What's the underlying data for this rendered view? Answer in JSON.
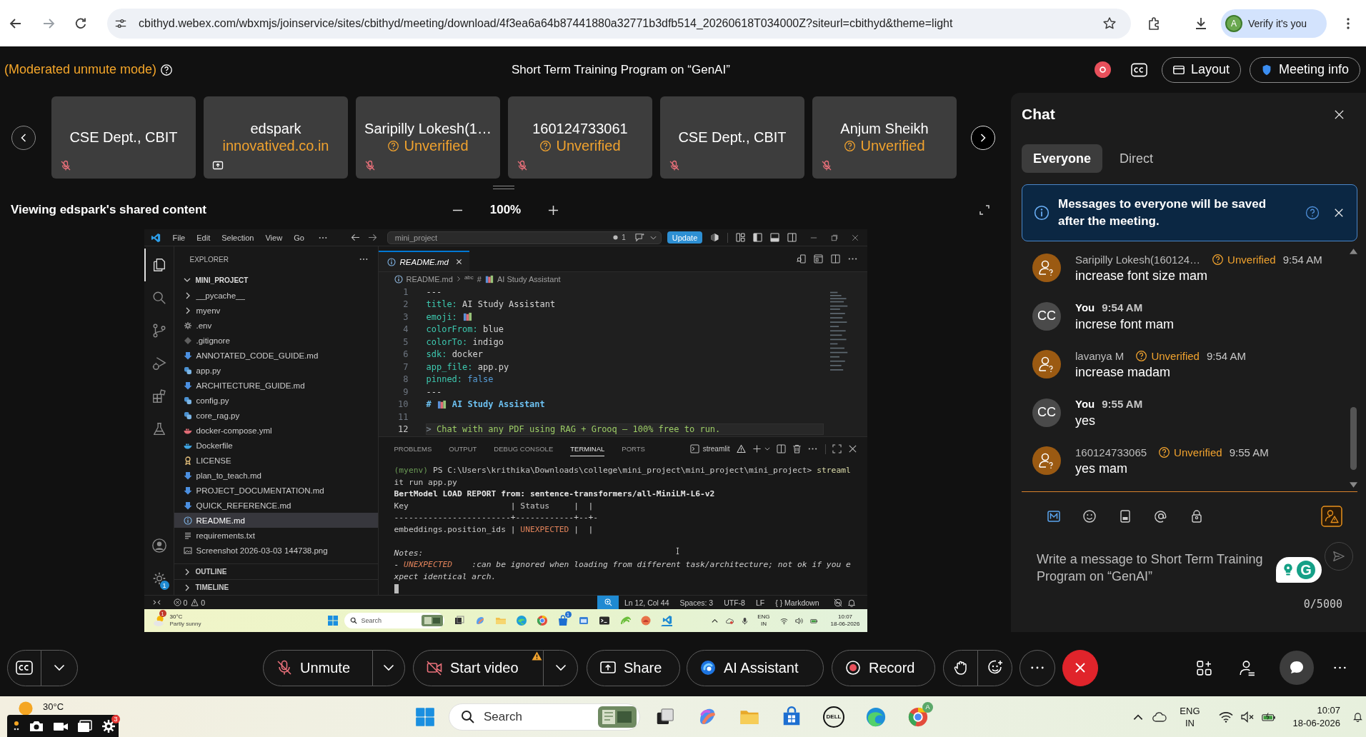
{
  "browser": {
    "url": "cbithyd.webex.com/wbxmjs/joinservice/sites/cbithyd/meeting/download/4f3ea6a64b87441880a32771b3dfb514_20260618T034000Z?siteurl=cbithyd&theme=light",
    "profile_initial": "A",
    "profile_label": "Verify it's you"
  },
  "meeting": {
    "mode_notice": "(Moderated unmute mode)",
    "title": "Short Term Training Program on “GenAI”",
    "layout_button": "Layout",
    "info_button": "Meeting info"
  },
  "participants": [
    {
      "name": "CSE Dept., CBIT",
      "muted": true,
      "sharing": false
    },
    {
      "name": "edspark",
      "note": "innovatived.co.in",
      "unverified": false,
      "muted": false,
      "sharing": true
    },
    {
      "name": "Saripilly Lokesh(1…",
      "note": "Unverified",
      "unverified": true,
      "muted": true,
      "sharing": false
    },
    {
      "name": "160124733061",
      "note": "Unverified",
      "unverified": true,
      "muted": true,
      "sharing": false
    },
    {
      "name": "CSE Dept., CBIT",
      "muted": true,
      "sharing": false
    },
    {
      "name": "Anjum Sheikh",
      "note": "Unverified",
      "unverified": true,
      "muted": true,
      "sharing": false
    }
  ],
  "share": {
    "caption": "Viewing edspark's shared content",
    "zoom": "100%"
  },
  "vscode": {
    "menu": [
      "File",
      "Edit",
      "Selection",
      "View",
      "Go"
    ],
    "command_center": "mini_project",
    "changes_count": "1",
    "update_button": "Update",
    "settings_badge": "1",
    "explorer_title": "EXPLORER",
    "project": "MINI_PROJECT",
    "files": [
      {
        "name": "__pycache__",
        "kind": "folder",
        "selected": false
      },
      {
        "name": "myenv",
        "kind": "folder",
        "selected": false
      },
      {
        "name": ".env",
        "kind": "settings",
        "selected": false
      },
      {
        "name": ".gitignore",
        "kind": "git",
        "selected": false
      },
      {
        "name": "ANNOTATED_CODE_GUIDE.md",
        "kind": "markdown",
        "selected": false
      },
      {
        "name": "app.py",
        "kind": "python",
        "selected": false
      },
      {
        "name": "ARCHITECTURE_GUIDE.md",
        "kind": "markdown",
        "selected": false
      },
      {
        "name": "config.py",
        "kind": "python",
        "selected": false
      },
      {
        "name": "core_rag.py",
        "kind": "python",
        "selected": false
      },
      {
        "name": "docker-compose.yml",
        "kind": "compose",
        "selected": false
      },
      {
        "name": "Dockerfile",
        "kind": "docker",
        "selected": false
      },
      {
        "name": "LICENSE",
        "kind": "license",
        "selected": false
      },
      {
        "name": "plan_to_teach.md",
        "kind": "markdown",
        "selected": false
      },
      {
        "name": "PROJECT_DOCUMENTATION.md",
        "kind": "markdown",
        "selected": false
      },
      {
        "name": "QUICK_REFERENCE.md",
        "kind": "markdown",
        "selected": false
      },
      {
        "name": "README.md",
        "kind": "readme",
        "selected": true
      },
      {
        "name": "requirements.txt",
        "kind": "text",
        "selected": false
      },
      {
        "name": "Screenshot 2026-03-03 144738.png",
        "kind": "image",
        "selected": false
      }
    ],
    "sections": [
      "OUTLINE",
      "TIMELINE"
    ],
    "tab": "README.md",
    "breadcrumb": {
      "file": "README.md",
      "symbol_tag": "abc",
      "heading_mark": "#",
      "heading": "AI Study Assistant"
    },
    "lines": [
      {
        "number": "1",
        "kind": "rule",
        "text": "---",
        "current": false
      },
      {
        "number": "2",
        "kind": "pair",
        "key": "title:",
        "value": "AI Study Assistant",
        "current": false
      },
      {
        "number": "3",
        "kind": "emoji",
        "key": "emoji:",
        "current": false
      },
      {
        "number": "4",
        "kind": "pair",
        "key": "colorFrom:",
        "value": "blue",
        "current": false
      },
      {
        "number": "5",
        "kind": "pair",
        "key": "colorTo:",
        "value": "indigo",
        "current": false
      },
      {
        "number": "6",
        "kind": "pair",
        "key": "sdk:",
        "value": "docker",
        "current": false
      },
      {
        "number": "7",
        "kind": "pair",
        "key": "app_file:",
        "value": "app.py",
        "current": false
      },
      {
        "number": "8",
        "kind": "boolean",
        "key": "pinned:",
        "value": "false",
        "current": false
      },
      {
        "number": "9",
        "kind": "rule",
        "text": "---",
        "current": false
      },
      {
        "number": "10",
        "kind": "heading",
        "mark": "#",
        "text": "AI Study Assistant",
        "current": false
      },
      {
        "number": "11",
        "kind": "blank",
        "current": false
      },
      {
        "number": "12",
        "kind": "quote",
        "mark": ">",
        "text": "Chat with any PDF using RAG + Grooq — 100% free to run.",
        "current": true
      }
    ],
    "panel_tabs": [
      {
        "label": "PROBLEMS",
        "selected": false
      },
      {
        "label": "OUTPUT",
        "selected": false
      },
      {
        "label": "DEBUG CONSOLE",
        "selected": false
      },
      {
        "label": "TERMINAL",
        "selected": true
      },
      {
        "label": "PORTS",
        "selected": false
      }
    ],
    "terminal_name": "streamlit",
    "terminal": [
      {
        "kind": "text",
        "segments": [
          {
            "text": "(myenv)",
            "kind": "env"
          },
          {
            "text": " PS C:\\Users\\krithika\\Downloads\\college\\mini_project\\mini_project\\mini_project> ",
            "kind": "plain"
          },
          {
            "text": "streaml",
            "kind": "command"
          }
        ]
      },
      {
        "kind": "text",
        "segments": [
          {
            "text": "it run app.py",
            "kind": "plain"
          }
        ]
      },
      {
        "kind": "text",
        "segments": [
          {
            "text": "BertModel LOAD REPORT from: sentence-transformers/all-MiniLM-L6-v2",
            "kind": "strong"
          }
        ]
      },
      {
        "kind": "text",
        "segments": [
          {
            "text": "Key                     | Status     |  |",
            "kind": "plain"
          }
        ]
      },
      {
        "kind": "text",
        "segments": [
          {
            "text": "------------------------+------------+--+-",
            "kind": "plain"
          }
        ]
      },
      {
        "kind": "text",
        "segments": [
          {
            "text": "embeddings.position_ids | ",
            "kind": "plain"
          },
          {
            "text": "UNEXPECTED",
            "kind": "warn"
          },
          {
            "text": " |  |",
            "kind": "plain"
          }
        ]
      },
      {
        "kind": "blank"
      },
      {
        "kind": "text",
        "segments": [
          {
            "text": "Notes:",
            "kind": "note"
          }
        ]
      },
      {
        "kind": "text",
        "segments": [
          {
            "text": "- ",
            "kind": "note"
          },
          {
            "text": "UNEXPECTED",
            "kind": "note_warn"
          },
          {
            "text": "    :can be ignored when loading from different task/architecture; not ok if you e",
            "kind": "note"
          }
        ]
      },
      {
        "kind": "text",
        "segments": [
          {
            "text": "xpect identical arch.",
            "kind": "note"
          }
        ]
      },
      {
        "kind": "cursor"
      }
    ],
    "status": {
      "errors": "0",
      "warnings": "0",
      "items": [
        "Ln 12, Col 44",
        "Spaces: 3",
        "UTF-8",
        "LF",
        "{ } Markdown"
      ]
    },
    "taskbar": {
      "temperature": "30°C",
      "weather": "Partly sunny",
      "weather_badge": "1",
      "search": "Search",
      "store_badge": "1",
      "language": "ENG",
      "region": "IN",
      "time": "10:07",
      "date": "18-06-2026"
    }
  },
  "chat": {
    "title": "Chat",
    "tabs": [
      {
        "label": "Everyone",
        "selected": true
      },
      {
        "label": "Direct",
        "selected": false
      }
    ],
    "notice": "Messages to everyone will be saved after the meeting.",
    "messages": [
      {
        "kind": "guest",
        "sender": "Saripilly Lokesh(160124…",
        "badge": "Unverified",
        "time": "9:54 AM",
        "text": "increase font size mam"
      },
      {
        "kind": "self",
        "initials": "CC",
        "sender": "You",
        "time": "9:54 AM",
        "text": "increse font mam"
      },
      {
        "kind": "guest",
        "sender": "lavanya M",
        "badge": "Unverified",
        "time": "9:54 AM",
        "text": "increase madam"
      },
      {
        "kind": "self",
        "initials": "CC",
        "sender": "You",
        "time": "9:55 AM",
        "text": "yes"
      },
      {
        "kind": "guest",
        "sender": "160124733065",
        "badge": "Unverified",
        "time": "9:55 AM",
        "text": "yes mam"
      }
    ],
    "placeholder": "Write a message to Short Term Training Program on “GenAI”",
    "counter": "0/5000",
    "assistant_letter": "G"
  },
  "controls": {
    "unmute": "Unmute",
    "video": "Start video",
    "share": "Share",
    "assistant": "AI Assistant",
    "record": "Record"
  },
  "taskbar": {
    "temperature": "30°C",
    "recorder_badge": "3",
    "search": "Search",
    "dell_label": "DELL",
    "chrome_badge": "A",
    "language": "ENG",
    "region": "IN",
    "time": "10:07",
    "date": "18-06-2026"
  }
}
